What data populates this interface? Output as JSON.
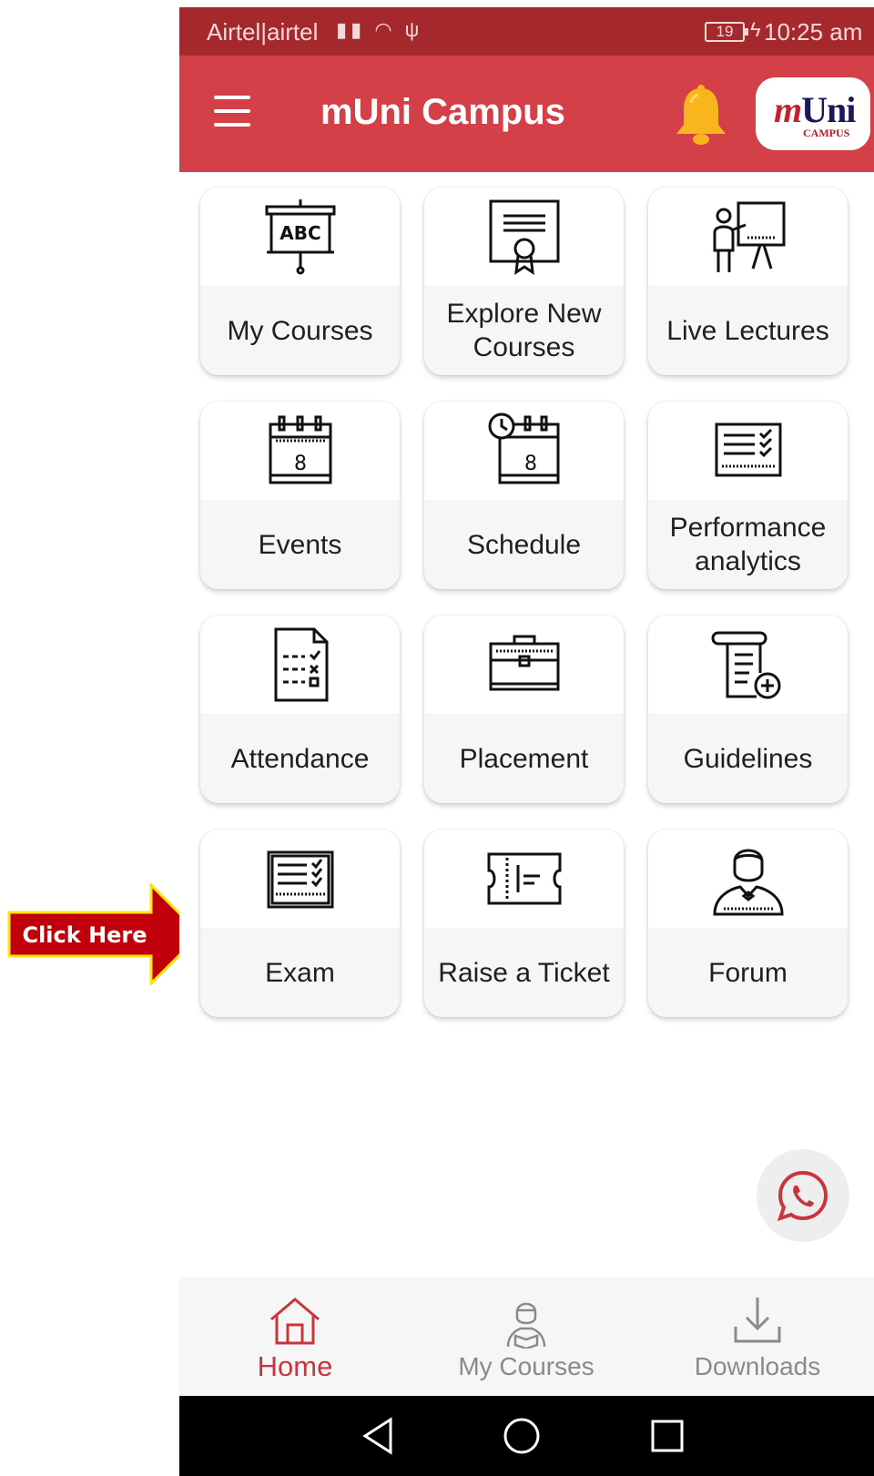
{
  "status_bar": {
    "carrier": "Airtel|airtel",
    "battery": "19",
    "time": "10:25 am"
  },
  "app_bar": {
    "title": "mUni Campus",
    "logo_text": "Uni",
    "logo_prefix": "m",
    "logo_sub": "CAMPUS"
  },
  "tiles": [
    {
      "label": "My Courses",
      "icon": "abc-board-icon"
    },
    {
      "label": "Explore New Courses",
      "icon": "certificate-icon"
    },
    {
      "label": "Live Lectures",
      "icon": "lecturer-board-icon"
    },
    {
      "label": "Events",
      "icon": "calendar-icon"
    },
    {
      "label": "Schedule",
      "icon": "calendar-clock-icon"
    },
    {
      "label": "Performance analytics",
      "icon": "checklist-board-icon"
    },
    {
      "label": "Attendance",
      "icon": "document-check-icon"
    },
    {
      "label": "Placement",
      "icon": "briefcase-icon"
    },
    {
      "label": "Guidelines",
      "icon": "scroll-plus-icon"
    },
    {
      "label": "Exam",
      "icon": "exam-board-icon"
    },
    {
      "label": "Raise a Ticket",
      "icon": "ticket-icon"
    },
    {
      "label": "Forum",
      "icon": "person-icon"
    }
  ],
  "callout": {
    "label": "Click Here",
    "color": "#c0000b"
  },
  "bottom_nav": [
    {
      "label": "Home",
      "icon": "home-icon",
      "active": true
    },
    {
      "label": "My Courses",
      "icon": "student-icon",
      "active": false
    },
    {
      "label": "Downloads",
      "icon": "download-icon",
      "active": false
    }
  ],
  "colors": {
    "status_bar": "#a5282d",
    "app_bar": "#d34048",
    "accent": "#c9353d",
    "bell": "#f8b51c"
  }
}
